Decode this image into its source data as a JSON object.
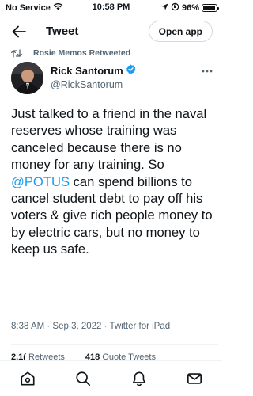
{
  "status_bar": {
    "carrier": "No Service",
    "time": "10:58 PM",
    "battery_text": "96%",
    "battery_level": 0.96
  },
  "nav": {
    "title": "Tweet",
    "open_app_label": "Open app",
    "back_icon": "arrow-left-icon"
  },
  "retweet": {
    "label": "Rosie Memos Retweeted",
    "icon": "retweet-icon"
  },
  "author": {
    "name": "Rick Santorum",
    "handle": "@RickSantorum",
    "verified": true,
    "accent_color": "#1d9bf0"
  },
  "tweet": {
    "text_before": "Just talked to a friend in the naval reserves whose training was canceled because there is no money for any training. So ",
    "mention": "@POTUS",
    "text_after": " can spend billions to cancel student debt to pay off his voters & give rich people money to by electric cars, but no money to keep us safe.",
    "timestamp": "8:38 AM · Sep 3, 2022 · Twitter for iPad"
  },
  "stats": {
    "retweets_count": "2,1(",
    "retweets_label": "Retweets",
    "quotes_count": "418",
    "quotes_label": "Quote Tweets"
  },
  "tabs": [
    {
      "icon": "home-icon"
    },
    {
      "icon": "search-icon"
    },
    {
      "icon": "notifications-bell-icon"
    },
    {
      "icon": "messages-mail-icon"
    }
  ]
}
